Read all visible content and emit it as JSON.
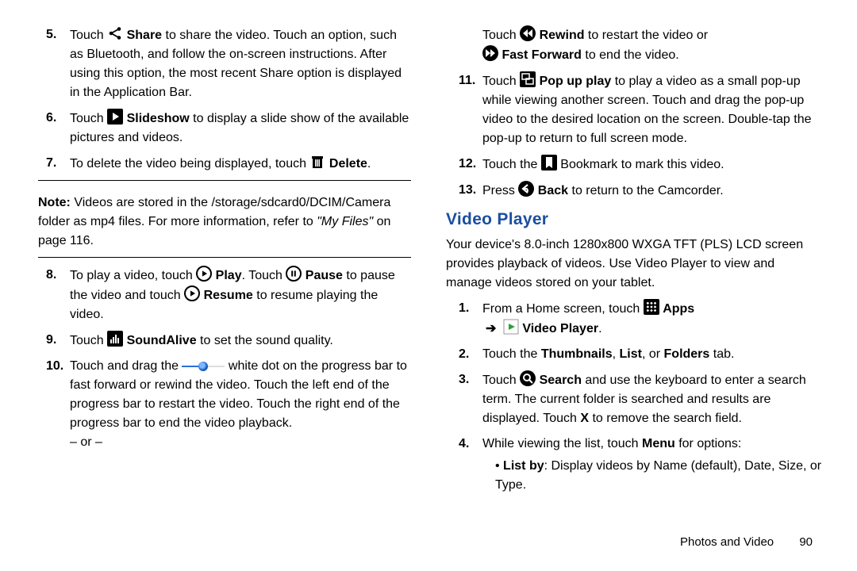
{
  "left": {
    "items5": {
      "num": "5.",
      "text1": "Touch ",
      "share_b": "Share",
      "text2": " to share the video. Touch an option, such as Bluetooth, and follow the on-screen instructions. After using this option, the most recent Share option is displayed in the Application Bar."
    },
    "items6": {
      "num": "6.",
      "text1": "Touch ",
      "slide_b": "Slideshow",
      "text2": " to display a slide show of the available pictures and videos."
    },
    "items7": {
      "num": "7.",
      "text1": "To delete the video being displayed, touch ",
      "del_b": "Delete",
      "text2": "."
    },
    "note": {
      "label": "Note:",
      "body1": " Videos are stored in the /storage/sdcard0/DCIM/Camera folder as mp4 files. For more information, refer to ",
      "em": "\"My Files\"",
      "body2": " on page 116."
    },
    "items8": {
      "num": "8.",
      "t1": "To play a video, touch ",
      "play_b": "Play",
      "t2": ". Touch ",
      "pause_b": "Pause",
      "t3": " to pause the video and touch ",
      "resume_b": "Resume",
      "t4": " to resume playing the video."
    },
    "items9": {
      "num": "9.",
      "t1": "Touch ",
      "sa_b": "SoundAlive",
      "t2": " to set the sound quality."
    },
    "items10": {
      "num": "10.",
      "t1": "Touch and drag the ",
      "t2": " white dot on the progress bar to fast forward or rewind the video. Touch the left end of the progress bar to restart the video. Touch the right end of the progress bar to end the video playback.",
      "or": "– or –"
    }
  },
  "right": {
    "pre10b": {
      "t1": "Touch ",
      "rw_b": "Rewind",
      "t2": " to restart the video or ",
      "ff_b": "Fast Forward",
      "t3": " to end the video."
    },
    "items11": {
      "num": "11.",
      "t1": "Touch ",
      "pop_b": "Pop up play",
      "t2": " to play a video as a small pop-up while viewing another screen. Touch and drag the pop-up video to the desired location on the screen. Double-tap the pop-up to return to full screen mode."
    },
    "items12": {
      "num": "12.",
      "t1": "Touch the ",
      "t2": " Bookmark to mark this video."
    },
    "items13": {
      "num": "13.",
      "t1": "Press ",
      "back_b": "Back",
      "t2": " to return to the Camcorder."
    },
    "section": "Video Player",
    "intro": "Your device's 8.0-inch 1280x800 WXGA TFT (PLS) LCD screen provides playback of videos. Use Video Player to view and manage videos stored on your tablet.",
    "vp1": {
      "num": "1.",
      "t1": "From a Home screen, touch ",
      "apps_b": "Apps",
      "arrow": "➔",
      "vp_b": "Video Player",
      "t2": "."
    },
    "vp2": {
      "num": "2.",
      "t1": "Touch the ",
      "thumb_b": "Thumbnails",
      "comma1": ", ",
      "list_b": "List",
      "comma2": ", or ",
      "fold_b": "Folders",
      "t2": " tab."
    },
    "vp3": {
      "num": "3.",
      "t1": "Touch ",
      "search_b": "Search",
      "t2": " and use the keyboard to enter a search term. The current folder is searched and results are displayed. Touch ",
      "x_b": "X",
      "t3": " to remove the search field."
    },
    "vp4": {
      "num": "4.",
      "t1": "While viewing the list, touch ",
      "menu_b": "Menu",
      "t2": " for options:",
      "bullet": {
        "lb": "List by",
        "txt": ": Display videos by Name (default), Date, Size, or Type."
      }
    }
  },
  "footer": {
    "label": "Photos and Video",
    "page": "90"
  }
}
